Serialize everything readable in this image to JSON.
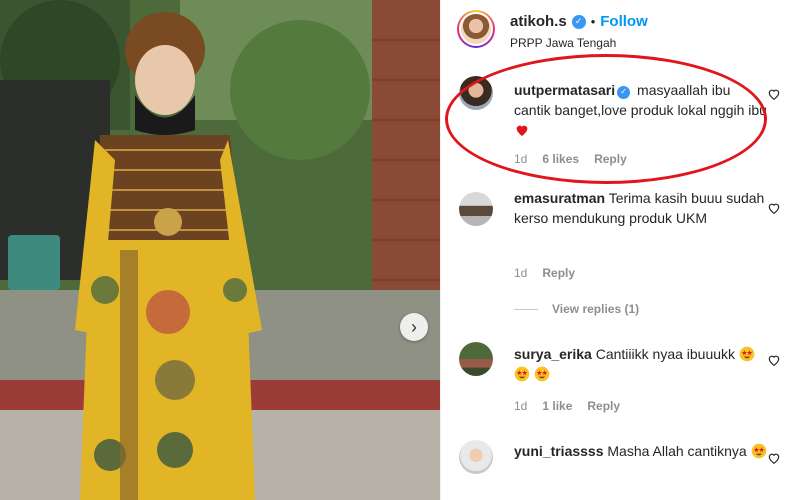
{
  "post": {
    "author": "atikoh.s",
    "follow_label": "Follow",
    "dot": "•",
    "location": "PRPP Jawa Tengah"
  },
  "carousel": {
    "next_icon": "chevron-right-icon"
  },
  "comments": [
    {
      "username": "uutpermatasari",
      "verified": true,
      "text": "masyaallah ibu cantik banget,love produk lokal nggih ibu",
      "emoji": "red-heart",
      "time": "1d",
      "likes": "6 likes",
      "reply_label": "Reply"
    },
    {
      "username": "emasuratman",
      "verified": false,
      "text": "Terima kasih buuu sudah kerso mendukung produk UKM",
      "time": "1d",
      "reply_label": "Reply",
      "view_replies": "View replies (1)"
    },
    {
      "username": "surya_erika",
      "verified": false,
      "text": "Cantiiikk nyaa ibuuukk",
      "emoji": "star-struck x3",
      "time": "1d",
      "likes": "1 like",
      "reply_label": "Reply"
    },
    {
      "username": "yuni_triassss",
      "verified": false,
      "text": "Masha Allah cantiknya",
      "emoji": "star-struck",
      "time": "",
      "reply_label": ""
    }
  ],
  "colors": {
    "link_blue": "#0095f6",
    "verified_blue": "#3897f0",
    "annotation_red": "#e0161c",
    "muted": "#8e8e8e"
  }
}
